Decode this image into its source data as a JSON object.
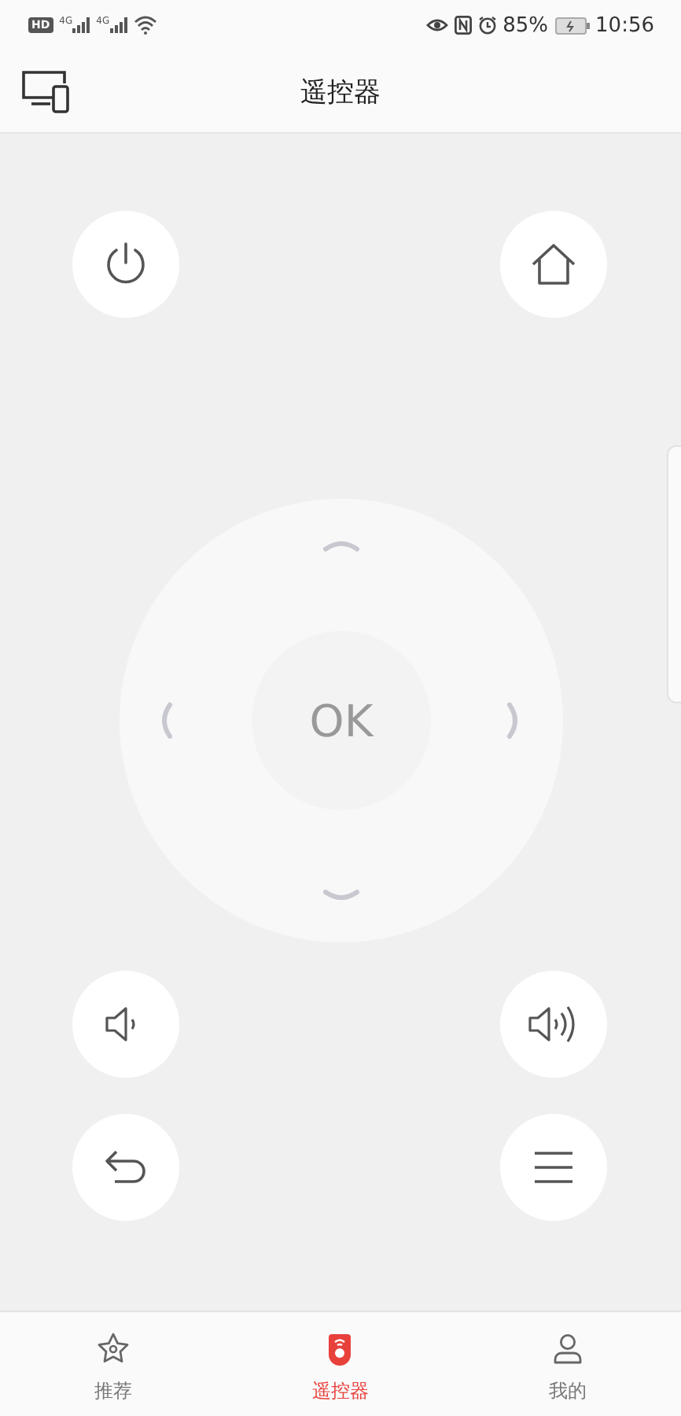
{
  "status_bar": {
    "hd_badge": "HD",
    "networks": [
      "4G",
      "4G"
    ],
    "battery_percent": "85%",
    "time": "10:56"
  },
  "header": {
    "title": "遥控器"
  },
  "remote": {
    "ok_label": "OK"
  },
  "tabs": [
    {
      "label": "推荐",
      "kind": "star",
      "selected": false
    },
    {
      "label": "遥控器",
      "kind": "remote",
      "selected": true
    },
    {
      "label": "我的",
      "kind": "person",
      "selected": false
    }
  ]
}
